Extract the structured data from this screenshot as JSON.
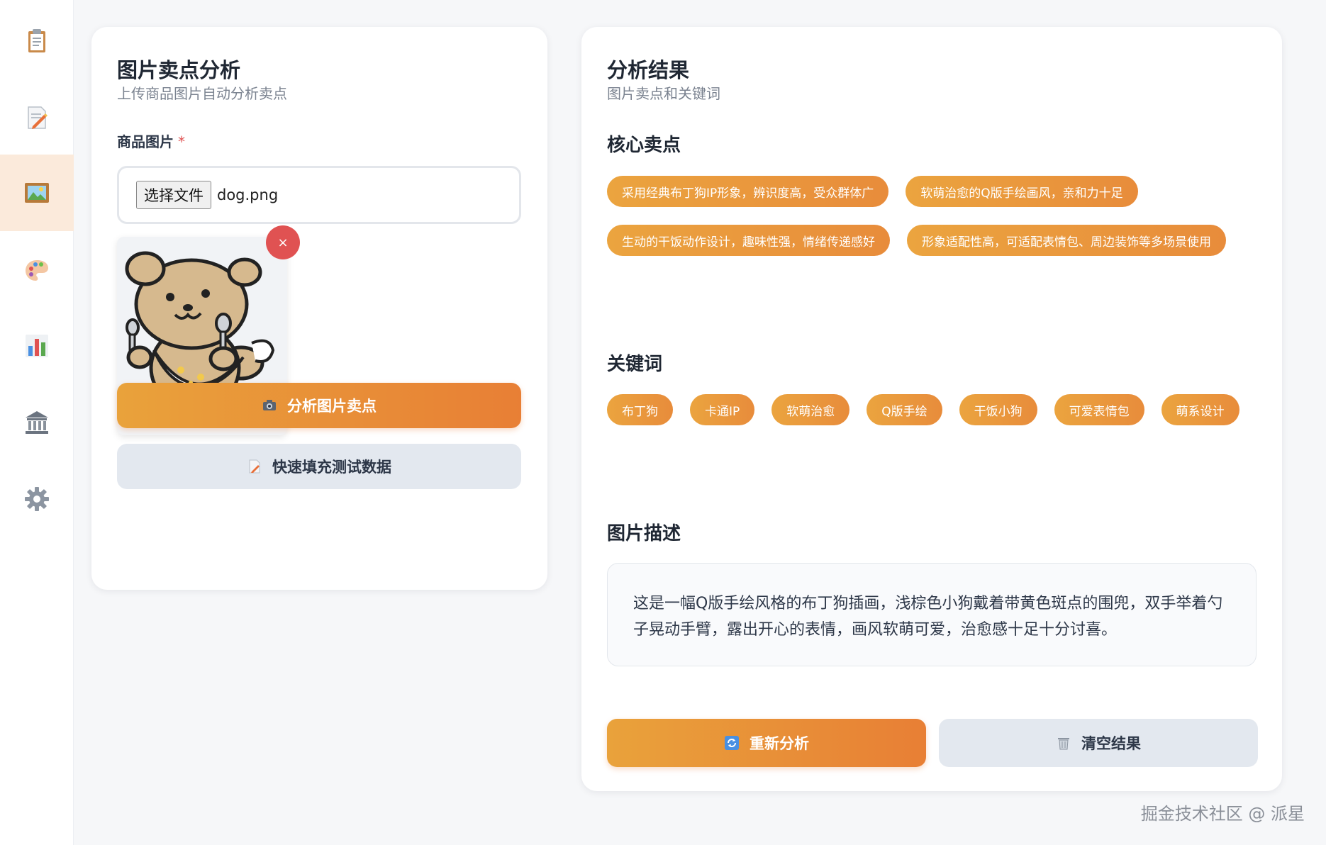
{
  "sidebar": {
    "items": [
      {
        "icon": "clipboard-icon"
      },
      {
        "icon": "memo-icon"
      },
      {
        "icon": "framed-picture-icon",
        "active": true
      },
      {
        "icon": "palette-icon"
      },
      {
        "icon": "bar-chart-icon"
      },
      {
        "icon": "bank-icon"
      },
      {
        "icon": "gear-icon"
      }
    ]
  },
  "left": {
    "title": "图片卖点分析",
    "subtitle": "上传商品图片自动分析卖点",
    "field_label": "商品图片",
    "required_mark": "*",
    "file_button": "选择文件",
    "file_name": "dog.png",
    "remove_label": "×",
    "analyze_button": "分析图片卖点",
    "fill_button": "快速填充测试数据"
  },
  "right": {
    "title": "分析结果",
    "subtitle": "图片卖点和关键词",
    "selling_points_title": "核心卖点",
    "selling_points": [
      "采用经典布丁狗IP形象，辨识度高，受众群体广",
      "软萌治愈的Q版手绘画风，亲和力十足",
      "生动的干饭动作设计，趣味性强，情绪传递感好",
      "形象适配性高，可适配表情包、周边装饰等多场景使用"
    ],
    "keywords_title": "关键词",
    "keywords": [
      "布丁狗",
      "卡通IP",
      "软萌治愈",
      "Q版手绘",
      "干饭小狗",
      "可爱表情包",
      "萌系设计"
    ],
    "description_title": "图片描述",
    "description": "这是一幅Q版手绘风格的布丁狗插画，浅棕色小狗戴着带黄色斑点的围兜，双手举着勺子晃动手臂，露出开心的表情，画风软萌可爱，治愈感十足十分讨喜。",
    "reanalyze_button": "重新分析",
    "clear_button": "清空结果"
  },
  "watermark": "掘金技术社区 @ 派星",
  "colors": {
    "accent_start": "#e9a23b",
    "accent_end": "#e87f35",
    "danger": "#e05252",
    "sidebar_active": "#fbeadb"
  }
}
